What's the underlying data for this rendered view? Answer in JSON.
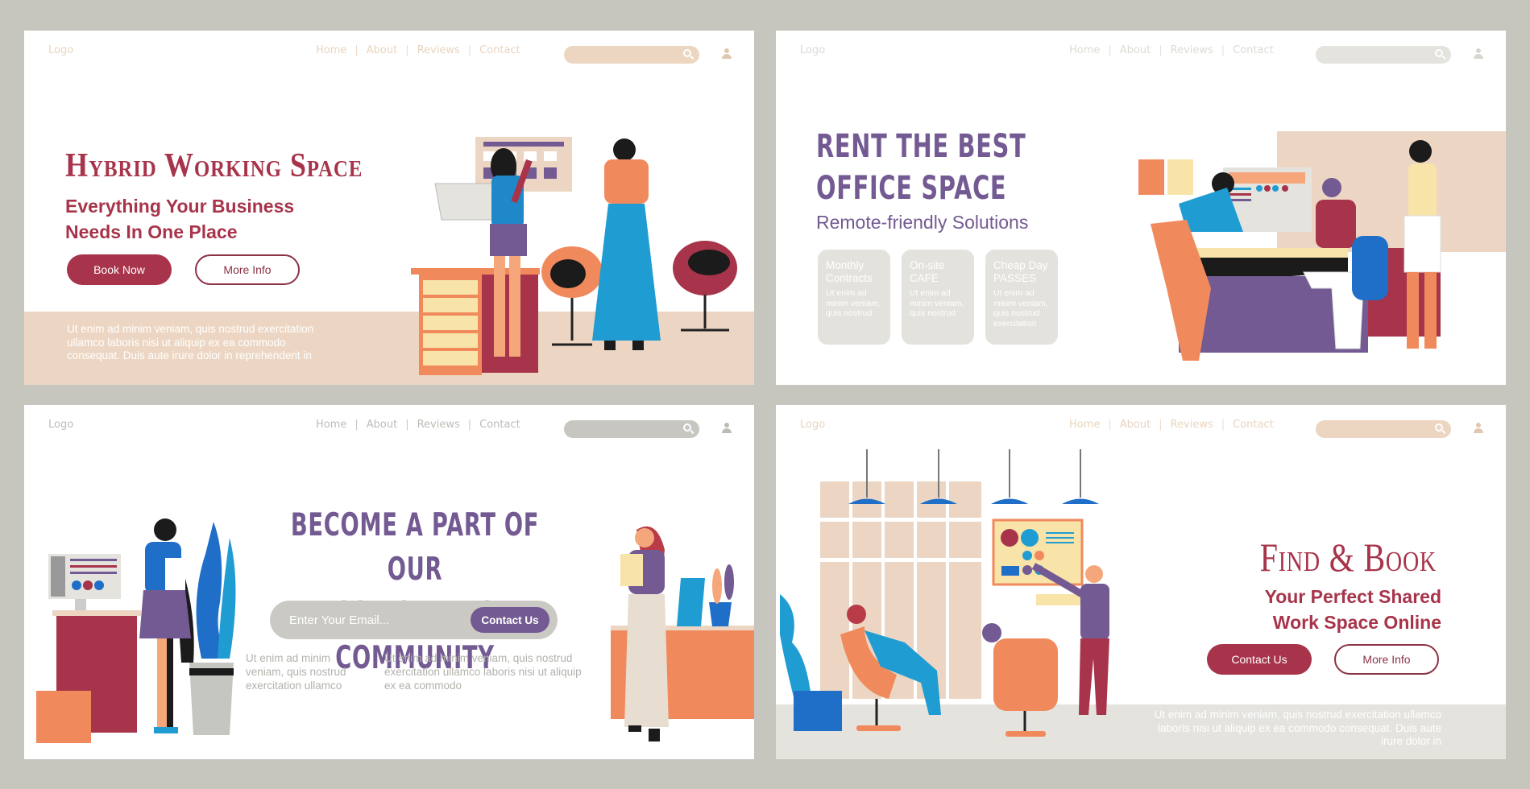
{
  "nav": {
    "logo": "Logo",
    "links": [
      "Home",
      "About",
      "Reviews",
      "Contact"
    ],
    "separator": "|",
    "search_placeholder": ""
  },
  "panels": [
    {
      "id": "hybrid",
      "title": "Hybrid Working Space",
      "subtitle_line1": "Everything Your Business",
      "subtitle_line2": "Needs In One Place",
      "primary_button": "Book Now",
      "secondary_button": "More Info",
      "body": [
        "Ut enim ad minim veniam, quis nostrud exercitation",
        "ullamco laboris nisi ut aliquip ex ea commodo",
        "consequat. Duis aute irure dolor in reprehenderit in"
      ],
      "accent": "#a7344a"
    },
    {
      "id": "rent",
      "title_line1": "RENT THE BEST",
      "title_line2": "OFFICE SPACE",
      "subtitle": "Remote-friendly Solutions",
      "cards": [
        {
          "title1": "Monthly",
          "title2": "Contracts",
          "body": "Ut enim ad minim veniam, quis nostrud"
        },
        {
          "title1": "On-site",
          "title2": "CAFE",
          "body": "Ut enim ad minim veniam, quis nostrud"
        },
        {
          "title1": "Cheap Day",
          "title2": "PASSES",
          "body": "Ut enim ad minim veniam, quis nostrud exercitation"
        }
      ],
      "accent": "#735a92"
    },
    {
      "id": "community",
      "title_line1": "BECOME A PART OF OUR",
      "title_line2": "COWORKING COMMUNITY",
      "email_placeholder": "Enter Your Email...",
      "button": "Contact Us",
      "col1": "Ut enim ad minim veniam, quis nostrud exercitation ullamco",
      "col2": "Ut enim ad minim veniam, quis nostrud exercitation ullamco laboris nisi ut aliquip ex ea commodo",
      "accent": "#735a92"
    },
    {
      "id": "findbook",
      "title": "Find & Book",
      "subtitle_line1": "Your Perfect Shared",
      "subtitle_line2": "Work Space Online",
      "primary_button": "Contact Us",
      "secondary_button": "More Info",
      "body": "Ut enim ad minim veniam, quis nostrud exercitation ullamco laboris nisi ut aliquip ex ea commodo consequat. Duis aute irure dolor in",
      "accent": "#a7344a"
    }
  ]
}
